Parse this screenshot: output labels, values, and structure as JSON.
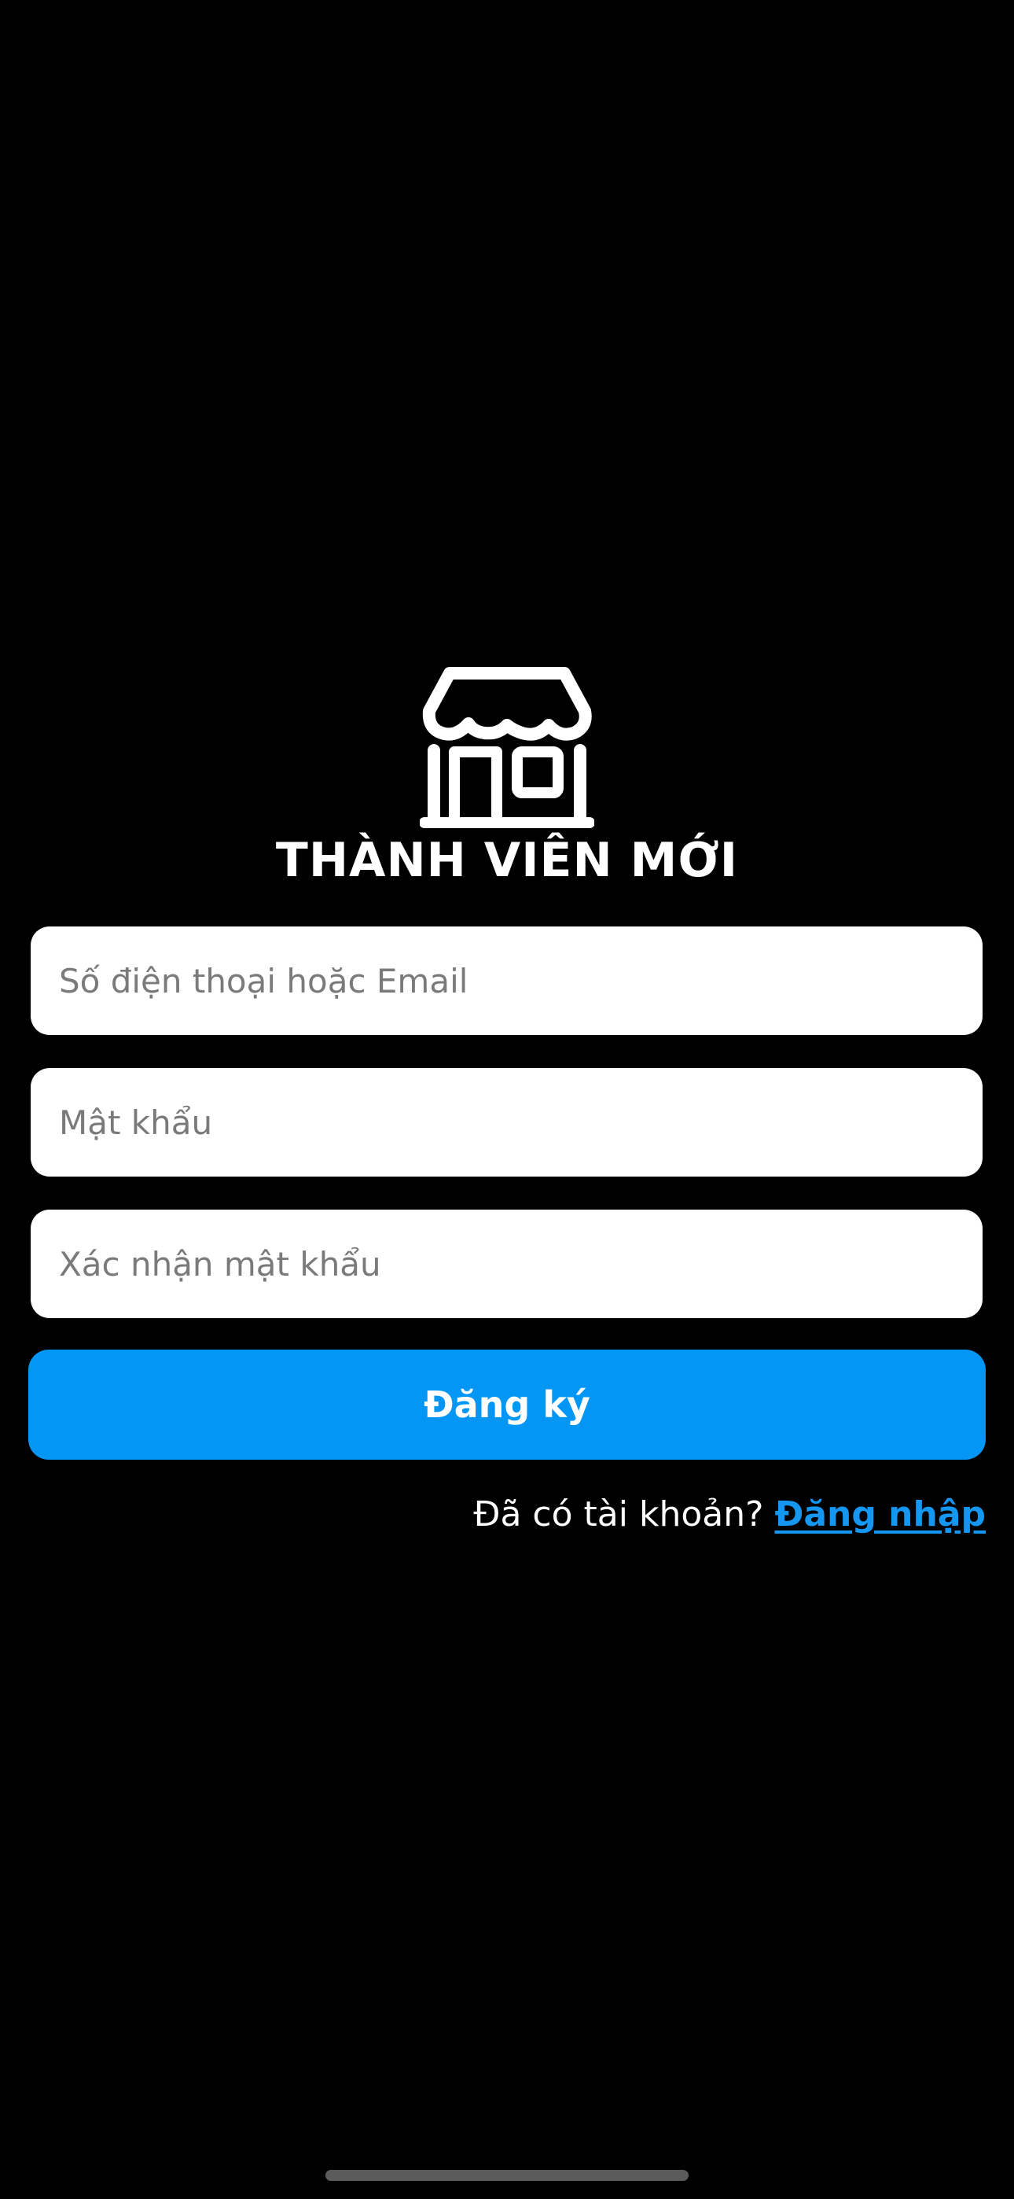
{
  "header": {
    "logo_icon": "store-icon",
    "title": "THÀNH VIÊN MỚI"
  },
  "form": {
    "phone_email_placeholder": "Số điện thoại hoặc Email",
    "phone_email_value": "",
    "password_placeholder": "Mật khẩu",
    "password_value": "",
    "confirm_password_placeholder": "Xác nhận mật khẩu",
    "confirm_password_value": "",
    "register_label": "Đăng ký"
  },
  "footer": {
    "question": "Đã có tài khoản?",
    "login_link": "Đăng nhập"
  },
  "colors": {
    "background": "#000000",
    "primary": "#0396F4",
    "link": "#1596F0",
    "input_background": "#FFFFFF",
    "placeholder": "#7A7A7A"
  }
}
